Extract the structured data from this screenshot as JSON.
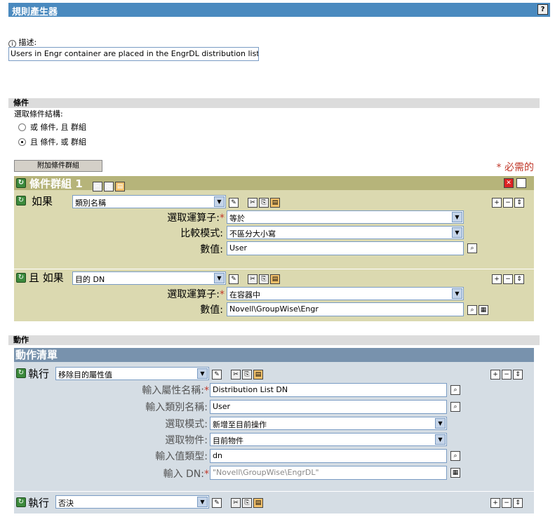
{
  "title": "規則產生器",
  "help_label": "?",
  "description": {
    "label": "描述:",
    "value": "Users in Engr container are placed in the EngrDL distribution list"
  },
  "conditions": {
    "section_label": "條件",
    "structure_label": "選取條件結構:",
    "options": [
      "或 條件, 且 群組",
      "且 條件, 或 群組"
    ],
    "selected_index": 1,
    "append_button": "附加條件群組",
    "required_note": "* 必需的",
    "group": {
      "title": "條件群組 1",
      "rows": [
        {
          "keyword": "如果",
          "selector": "類別名稱",
          "fields": [
            {
              "label": "選取運算子:",
              "required": true,
              "type": "select",
              "value": "等於"
            },
            {
              "label": "比較模式:",
              "required": false,
              "type": "select",
              "value": "不區分大小寫"
            },
            {
              "label": "數值:",
              "required": false,
              "type": "input",
              "value": "User"
            }
          ]
        },
        {
          "keyword": "且 如果",
          "selector": "目的 DN",
          "fields": [
            {
              "label": "選取運算子:",
              "required": true,
              "type": "select",
              "value": "在容器中"
            },
            {
              "label": "數值:",
              "required": false,
              "type": "input",
              "value": "Novell\\GroupWise\\Engr"
            }
          ]
        }
      ]
    }
  },
  "actions": {
    "section_label": "動作",
    "list_title": "動作清單",
    "rows": [
      {
        "keyword": "執行",
        "selector": "移除目的屬性值",
        "fields": [
          {
            "label": "輸入屬性名稱:",
            "required": true,
            "type": "input",
            "value": "Distribution List DN"
          },
          {
            "label": "輸入類別名稱:",
            "required": false,
            "type": "input",
            "value": "User"
          },
          {
            "label": "選取模式:",
            "required": false,
            "type": "select",
            "value": "新增至目前操作"
          },
          {
            "label": "選取物件:",
            "required": false,
            "type": "select",
            "value": "目前物件"
          },
          {
            "label": "輸入值類型:",
            "required": false,
            "type": "input",
            "value": "dn"
          },
          {
            "label": "輸入 DN:",
            "required": true,
            "type": "input",
            "value": "\"Novell\\GroupWise\\EngrDL\""
          }
        ]
      },
      {
        "keyword": "執行",
        "selector": "否決"
      }
    ]
  },
  "colors": {
    "title_bar": "#4a8abf",
    "condition_header": "#b6b47a",
    "condition_panel": "#dbd9b0",
    "action_header": "#7892ad",
    "action_panel": "#d5dde4",
    "required": "#c0392b"
  }
}
